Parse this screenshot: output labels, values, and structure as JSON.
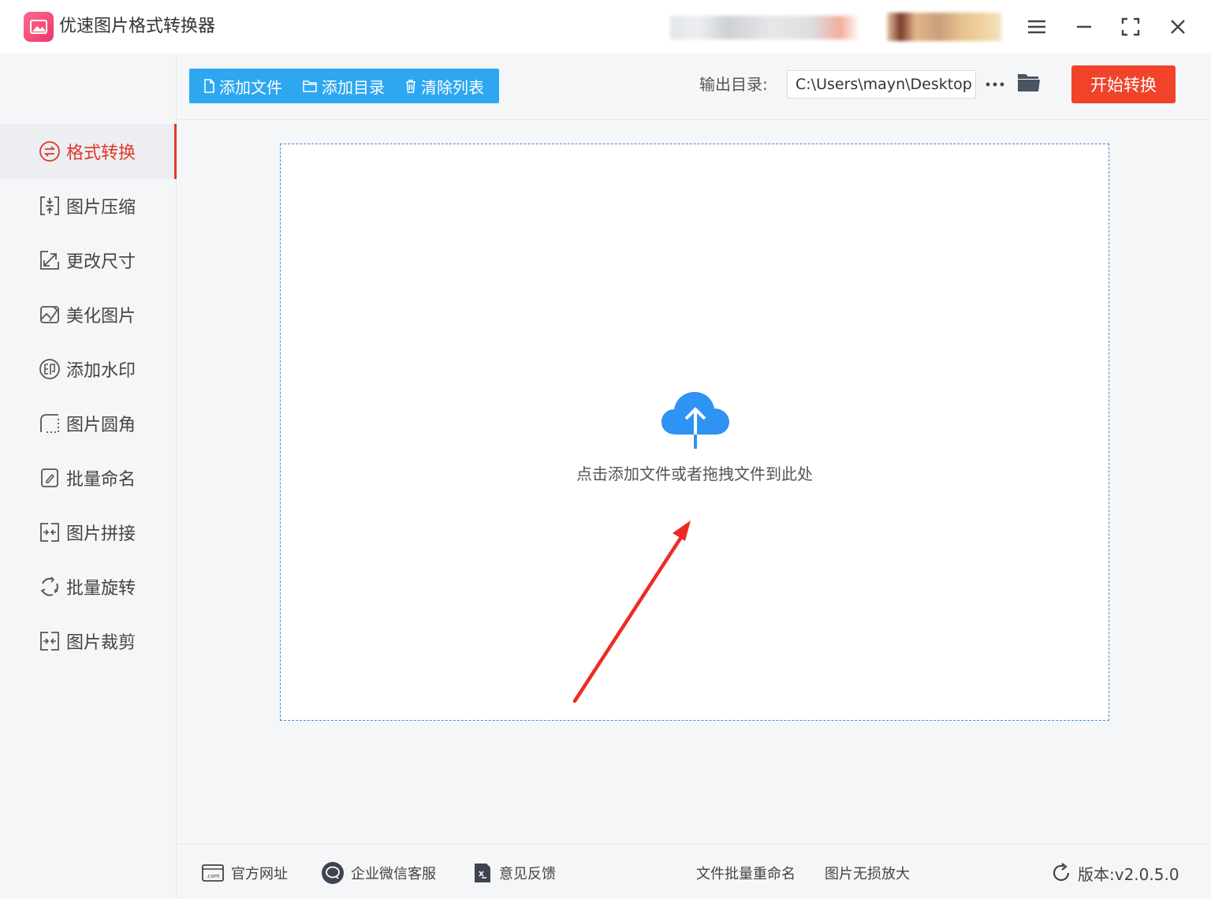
{
  "app": {
    "title": "优速图片格式转换器"
  },
  "sidebar": {
    "items": [
      {
        "label": "格式转换",
        "icon": "swap-circle-icon",
        "active": true
      },
      {
        "label": "图片压缩",
        "icon": "compress-icon"
      },
      {
        "label": "更改尺寸",
        "icon": "resize-icon"
      },
      {
        "label": "美化图片",
        "icon": "beautify-icon"
      },
      {
        "label": "添加水印",
        "icon": "watermark-icon"
      },
      {
        "label": "图片圆角",
        "icon": "round-corner-icon"
      },
      {
        "label": "批量命名",
        "icon": "rename-icon"
      },
      {
        "label": "图片拼接",
        "icon": "stitch-icon"
      },
      {
        "label": "批量旋转",
        "icon": "rotate-icon"
      },
      {
        "label": "图片裁剪",
        "icon": "crop-icon"
      }
    ]
  },
  "toolbar": {
    "add_file": "添加文件",
    "add_dir": "添加目录",
    "clear_list": "清除列表",
    "output_label": "输出目录:",
    "output_path": "C:\\Users\\mayn\\Desktop",
    "more": "···",
    "start": "开始转换"
  },
  "dropzone": {
    "hint": "点击添加文件或者拖拽文件到此处"
  },
  "footer": {
    "website": "官方网址",
    "wechat": "企业微信客服",
    "feedback": "意见反馈",
    "batch_rename": "文件批量重命名",
    "upscale": "图片无损放大",
    "version": "版本:v2.0.5.0"
  },
  "colors": {
    "accent_blue": "#2ea7f0",
    "start_red": "#f0432a",
    "active_red": "#e0382a",
    "annotation_red": "#ee2a24"
  }
}
